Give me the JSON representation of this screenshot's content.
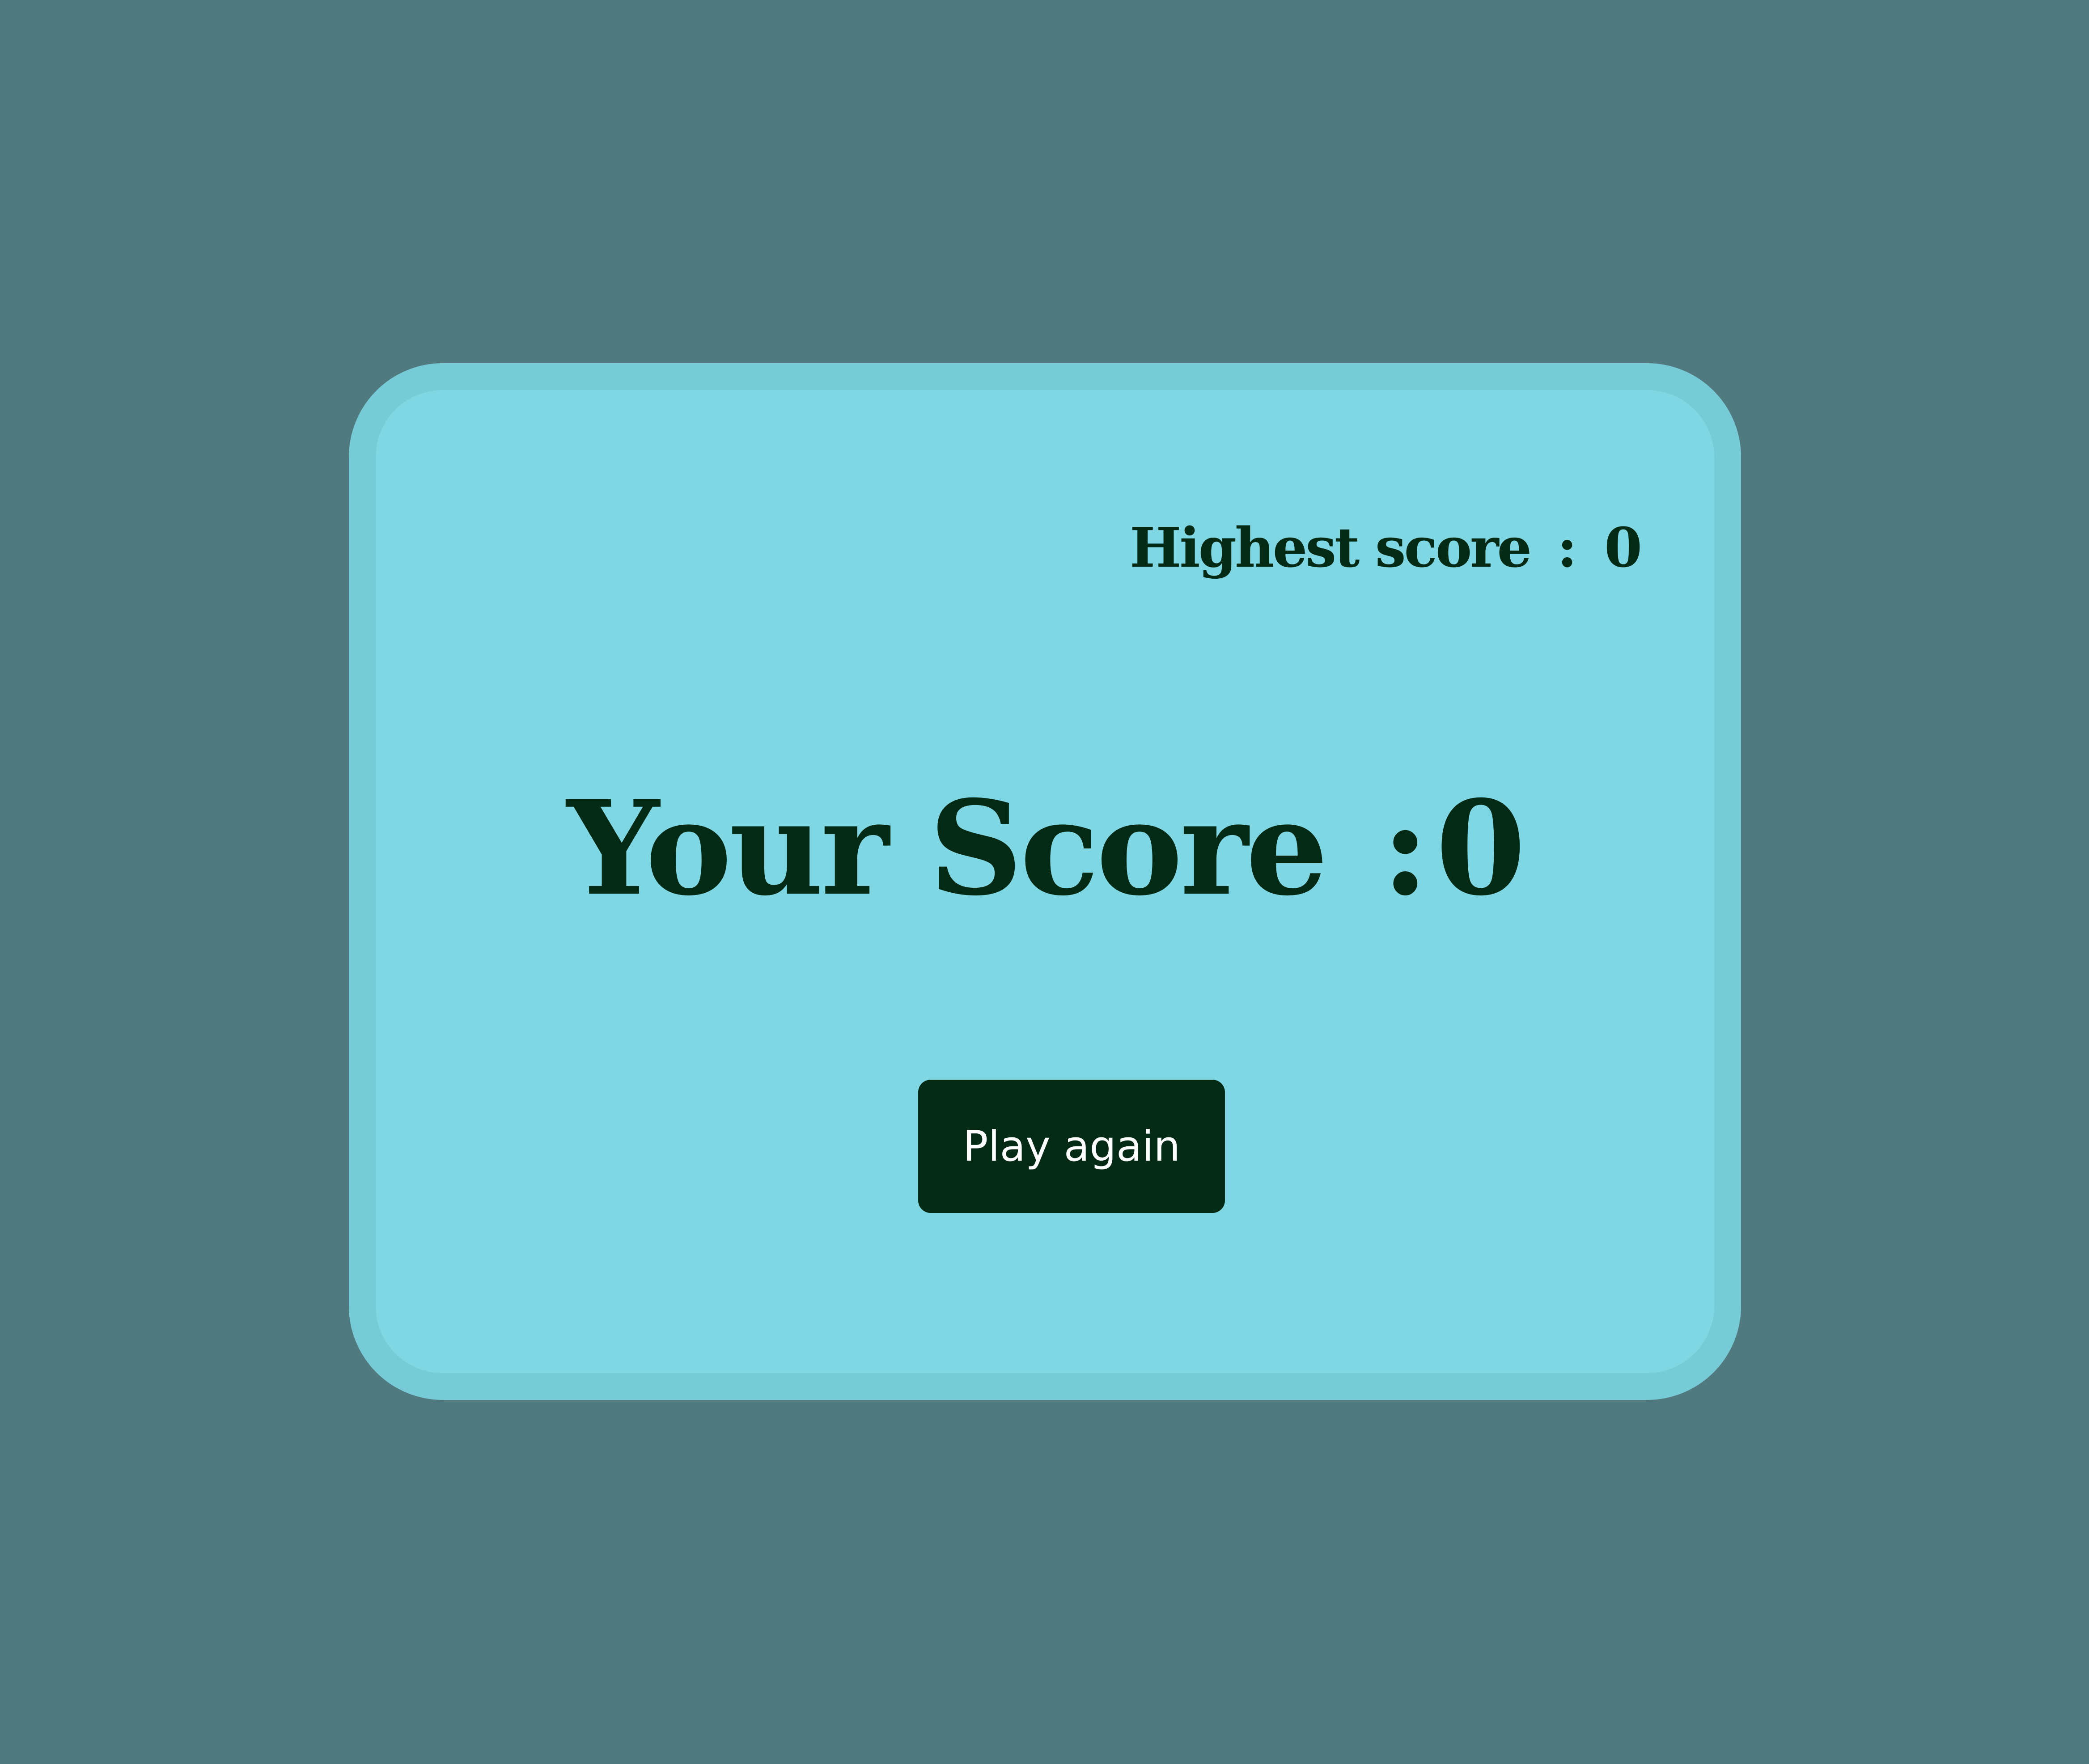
{
  "colors": {
    "background": "#517a80",
    "card_fill": "#7fd7e4",
    "card_border": "#76cbd6",
    "text_dark": "#032a15",
    "button_bg": "#032a15",
    "button_text": "#ffffff"
  },
  "highest_score": {
    "label": "Highest score",
    "separator": ":",
    "value": "0"
  },
  "your_score": {
    "label": "Your Score",
    "separator": ":",
    "value": "0"
  },
  "actions": {
    "play_again_label": "Play again"
  }
}
